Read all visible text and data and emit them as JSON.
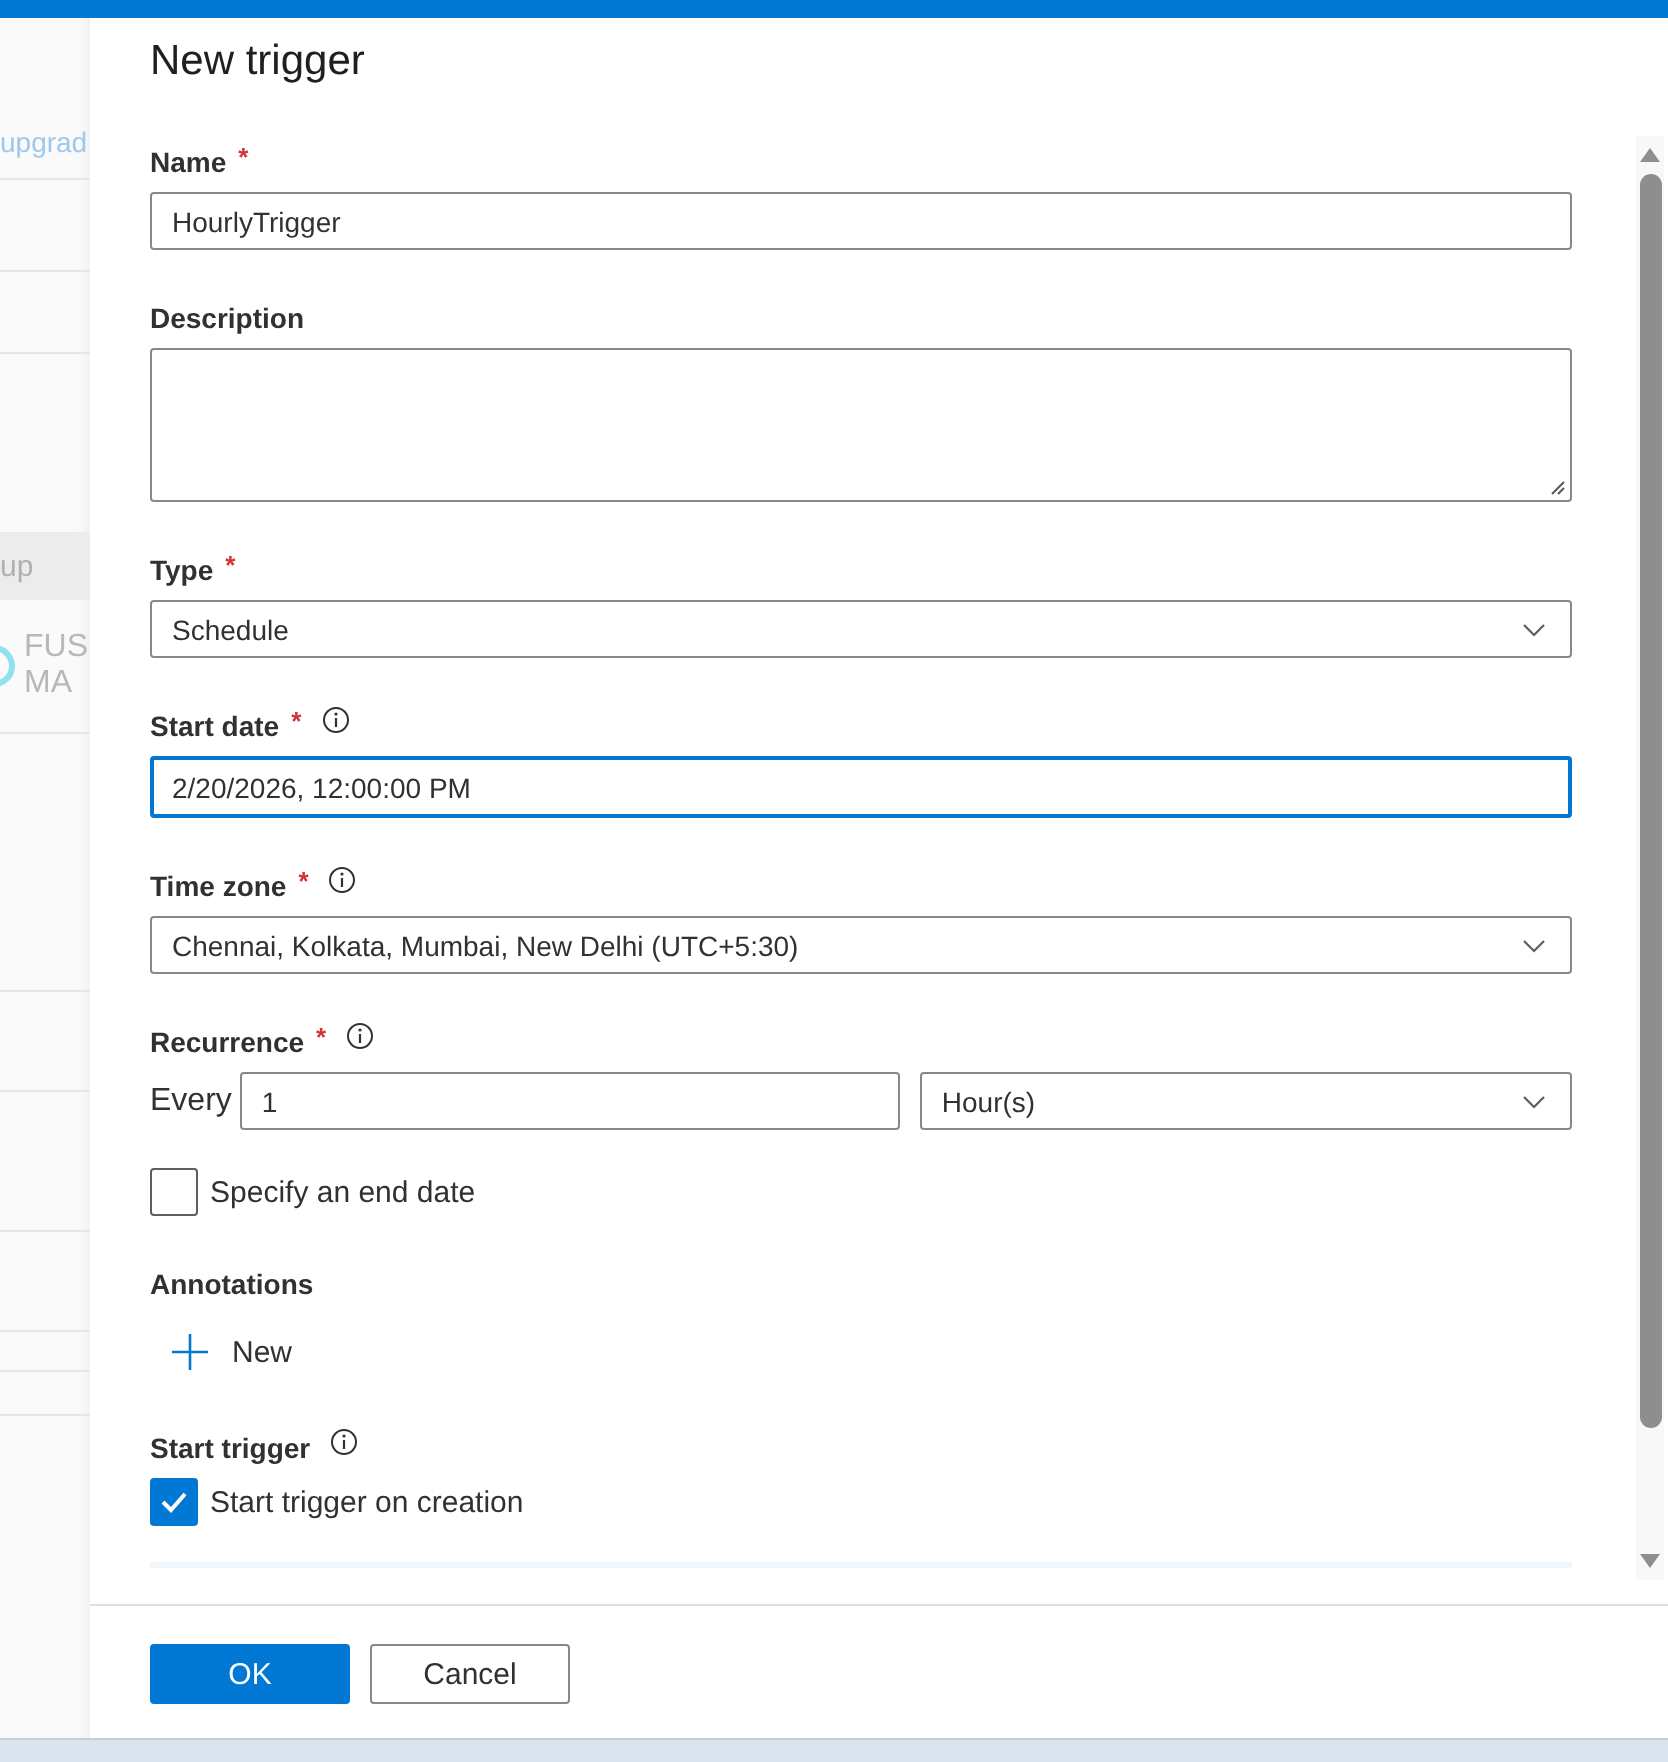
{
  "background": {
    "link": "upgrad",
    "group_header": "up",
    "item_lines": [
      "FUS",
      "MA"
    ]
  },
  "panel": {
    "title": "New trigger",
    "fields": [
      {
        "kind": "text",
        "label": "Name",
        "required_mark": "*",
        "value": "HourlyTrigger",
        "focused": false
      },
      {
        "kind": "textarea",
        "label": "Description"
      },
      {
        "kind": "select",
        "label": "Type",
        "required_mark": "*",
        "value": "Schedule"
      },
      {
        "kind": "text",
        "label": "Start date",
        "required_mark": "*",
        "info": true,
        "value": "2/20/2026, 12:00:00 PM",
        "focused": true
      },
      {
        "kind": "select",
        "label": "Time zone",
        "required_mark": "*",
        "info": true,
        "value": "Chennai, Kolkata, Mumbai, New Delhi (UTC+5:30)"
      },
      {
        "kind": "recurrence",
        "label": "Recurrence",
        "required_mark": "*",
        "info": true,
        "prefix": "Every",
        "interval": "1",
        "unit": "Hour(s)"
      },
      {
        "kind": "checkbox",
        "option": "Specify an end date",
        "checked": false
      },
      {
        "kind": "annotations",
        "label": "Annotations",
        "add": "New"
      },
      {
        "kind": "checkbox",
        "label": "Start trigger",
        "info": true,
        "option": "Start trigger on creation",
        "checked": true
      }
    ],
    "buttons": [
      {
        "label": "OK",
        "primary": true
      },
      {
        "label": "Cancel",
        "primary": false
      }
    ]
  }
}
